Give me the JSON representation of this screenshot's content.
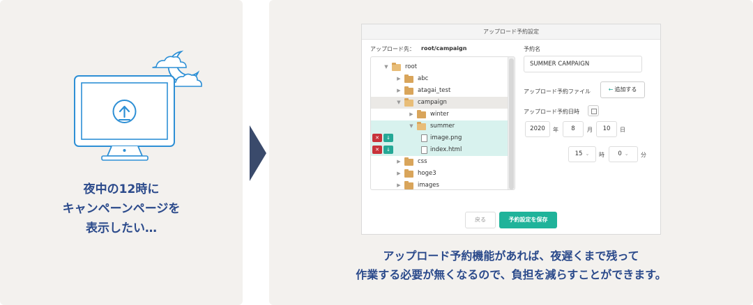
{
  "left": {
    "caption_lines": [
      "夜中の12時に",
      "キャンペーンページを",
      "表示したい…"
    ]
  },
  "dialog": {
    "title": "アップロード予約設定",
    "destination_label": "アップロード先：",
    "destination_value": "root/campaign",
    "tree": [
      {
        "label": "root",
        "type": "folder",
        "open": true
      },
      {
        "label": "abc",
        "type": "folder",
        "open": false
      },
      {
        "label": "atagai_test",
        "type": "folder",
        "open": false
      },
      {
        "label": "campaign",
        "type": "folder",
        "open": true,
        "selected": true
      },
      {
        "label": "winter",
        "type": "folder",
        "open": false
      },
      {
        "label": "summer",
        "type": "folder",
        "open": true
      },
      {
        "label": "image.png",
        "type": "file",
        "new": true
      },
      {
        "label": "index.html",
        "type": "file",
        "new": true
      },
      {
        "label": "css",
        "type": "folder",
        "open": false
      },
      {
        "label": "hoge3",
        "type": "folder",
        "open": false
      },
      {
        "label": "images",
        "type": "folder",
        "open": false
      }
    ],
    "name_label": "予約名",
    "name_value": "SUMMER CAMPAIGN",
    "file_label": "アップロード予約ファイル",
    "add_button": "追加する",
    "datetime_label": "アップロード予約日時",
    "year": "2020",
    "year_unit": "年",
    "month": "8",
    "month_unit": "月",
    "day": "10",
    "day_unit": "日",
    "hour": "15",
    "hour_unit": "時",
    "minute": "0",
    "minute_unit": "分",
    "back_button": "戻る",
    "save_button": "予約設定を保存"
  },
  "right": {
    "caption_lines": [
      "アップロード予約機能があれば、夜遅くまで残って",
      "作業する必要が無くなるので、負担を減らすことができます。"
    ]
  },
  "colors": {
    "panel_bg": "#f3f1ee",
    "caption": "#2b4a8b",
    "accent": "#1fb39a",
    "monitor": "#2d8fd5",
    "folder": "#d9a55b",
    "delete": "#c8323a"
  }
}
